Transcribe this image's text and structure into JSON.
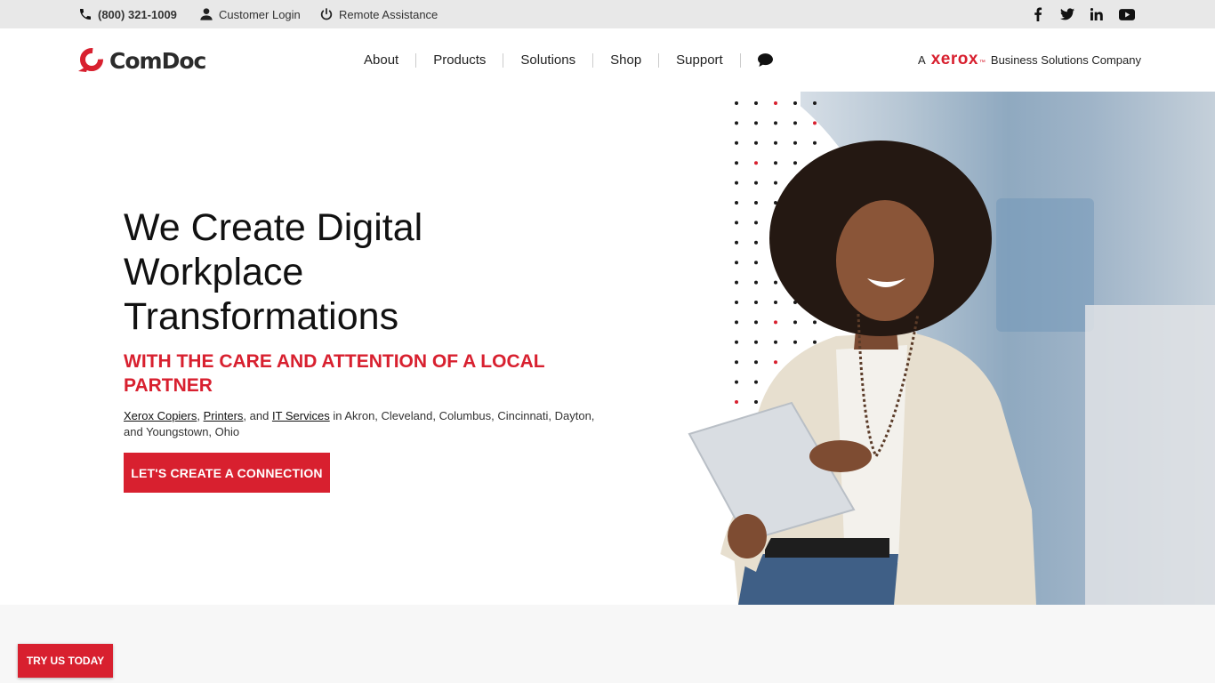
{
  "topbar": {
    "phone": "(800) 321-1009",
    "login": "Customer Login",
    "remote": "Remote Assistance",
    "social_icons": [
      "facebook-icon",
      "twitter-icon",
      "linkedin-icon",
      "youtube-icon"
    ]
  },
  "header": {
    "logo_text": "ComDoc",
    "nav": [
      "About",
      "Products",
      "Solutions",
      "Shop",
      "Support"
    ],
    "tagline_prefix": "A",
    "tagline_brand": "xerox",
    "tagline_tm": "™",
    "tagline_suffix": "Business Solutions Company"
  },
  "hero": {
    "title": "We Create Digital Workplace Transformations",
    "subtitle": "WITH THE CARE AND ATTENTION OF A LOCAL PARTNER",
    "body_link1": "Xerox Copiers",
    "body_sep1": ", ",
    "body_link2": "Printers",
    "body_sep2": ", and ",
    "body_link3": "IT Services",
    "body_rest": " in Akron, Cleveland, Columbus, Cincinnati, Dayton, and Youngstown, Ohio",
    "cta": "LET'S CREATE A CONNECTION"
  },
  "floating": {
    "try_label": "TRY US TODAY"
  },
  "colors": {
    "brand_red": "#d8202f",
    "topbar_bg": "#e8e8e8"
  }
}
